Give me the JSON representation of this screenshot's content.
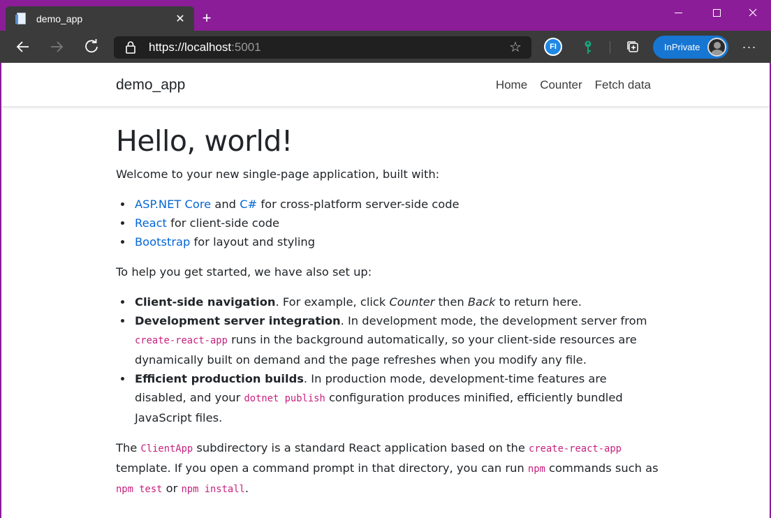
{
  "browser": {
    "tab_title": "demo_app",
    "tab_close": "✕",
    "new_tab": "+",
    "url_scheme": "https://",
    "url_host": "localhost",
    "url_port": ":5001",
    "inprivate_label": "InPrivate",
    "extension_label": "FI",
    "more_label": "···",
    "favorite_star": "☆"
  },
  "navbar": {
    "brand": "demo_app",
    "links": [
      "Home",
      "Counter",
      "Fetch data"
    ]
  },
  "main": {
    "heading": "Hello, world!",
    "intro": "Welcome to your new single-page application, built with:",
    "built_with": [
      {
        "link1": "ASP.NET Core",
        "mid": " and ",
        "link2": "C#",
        "rest": " for cross-platform server-side code"
      },
      {
        "link1": "React",
        "rest": " for client-side code"
      },
      {
        "link1": "Bootstrap",
        "rest": " for layout and styling"
      }
    ],
    "setup_intro": "To help you get started, we have also set up:",
    "features": [
      {
        "title": "Client-side navigation",
        "t1": ". For example, click ",
        "em1": "Counter",
        "t2": " then ",
        "em2": "Back",
        "t3": " to return here."
      },
      {
        "title": "Development server integration",
        "t1": ". In development mode, the development server from ",
        "code1": "create-react-app",
        "t2": " runs in the background automatically, so your client-side resources are dynamically built on demand and the page refreshes when you modify any file."
      },
      {
        "title": "Efficient production builds",
        "t1": ". In production mode, development-time features are disabled, and your ",
        "code1": "dotnet publish",
        "t2": " configuration produces minified, efficiently bundled JavaScript files."
      }
    ],
    "closing": {
      "t1": "The ",
      "code1": "ClientApp",
      "t2": " subdirectory is a standard React application based on the ",
      "code2": "create-react-app",
      "t3": " template. If you open a command prompt in that directory, you can run ",
      "code3": "npm",
      "t4": " commands such as ",
      "code4": "npm test",
      "t5": " or ",
      "code5": "npm install",
      "t6": "."
    }
  }
}
